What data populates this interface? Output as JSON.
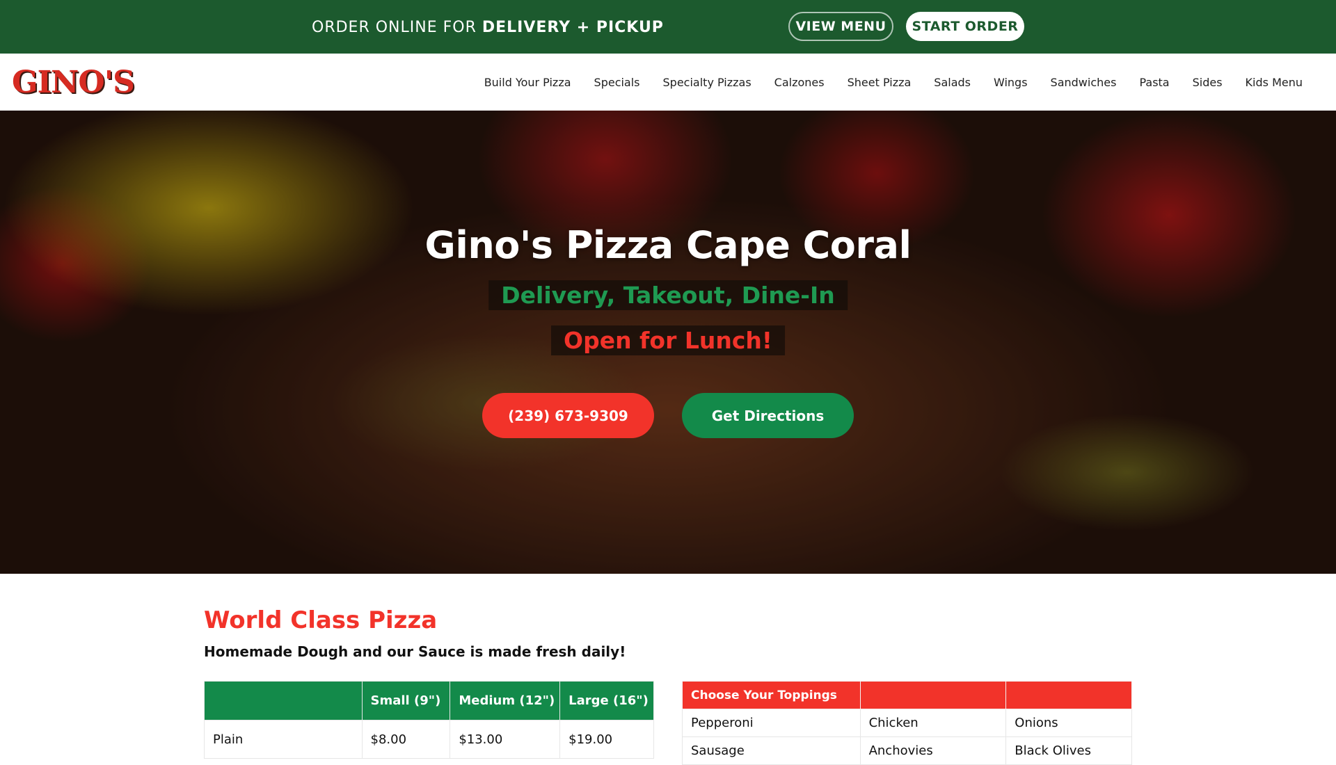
{
  "promo": {
    "text_regular": "ORDER ONLINE FOR",
    "text_bold": "DELIVERY + PICKUP",
    "view_menu": "VIEW MENU",
    "start_order": "START ORDER"
  },
  "nav": {
    "logo": "GINO'S",
    "links": [
      "Build Your Pizza",
      "Specials",
      "Specialty Pizzas",
      "Calzones",
      "Sheet Pizza",
      "Salads",
      "Wings",
      "Sandwiches",
      "Pasta",
      "Sides",
      "Kids Menu"
    ]
  },
  "hero": {
    "title": "Gino's Pizza Cape Coral",
    "tagline_1": "Delivery, Takeout, Dine-In",
    "tagline_2": "Open for Lunch!",
    "phone_button": "(239) 673-9309",
    "directions_button": "Get Directions"
  },
  "content": {
    "title": "World Class Pizza",
    "subtitle": "Homemade Dough and our Sauce is made fresh daily!"
  },
  "price_table": {
    "headers": [
      "",
      "Small (9\")",
      "Medium (12\")",
      "Large (16\")"
    ],
    "rows": [
      [
        "Plain",
        "$8.00",
        "$13.00",
        "$19.00"
      ]
    ]
  },
  "toppings_table": {
    "headers": [
      "Choose Your Toppings",
      "",
      ""
    ],
    "rows": [
      [
        "Pepperoni",
        "Chicken",
        "Onions"
      ],
      [
        "Sausage",
        "Anchovies",
        "Black Olives"
      ]
    ]
  },
  "colors": {
    "brand_green": "#1c5a2e",
    "accent_green": "#138a4a",
    "accent_red": "#f2332a"
  }
}
